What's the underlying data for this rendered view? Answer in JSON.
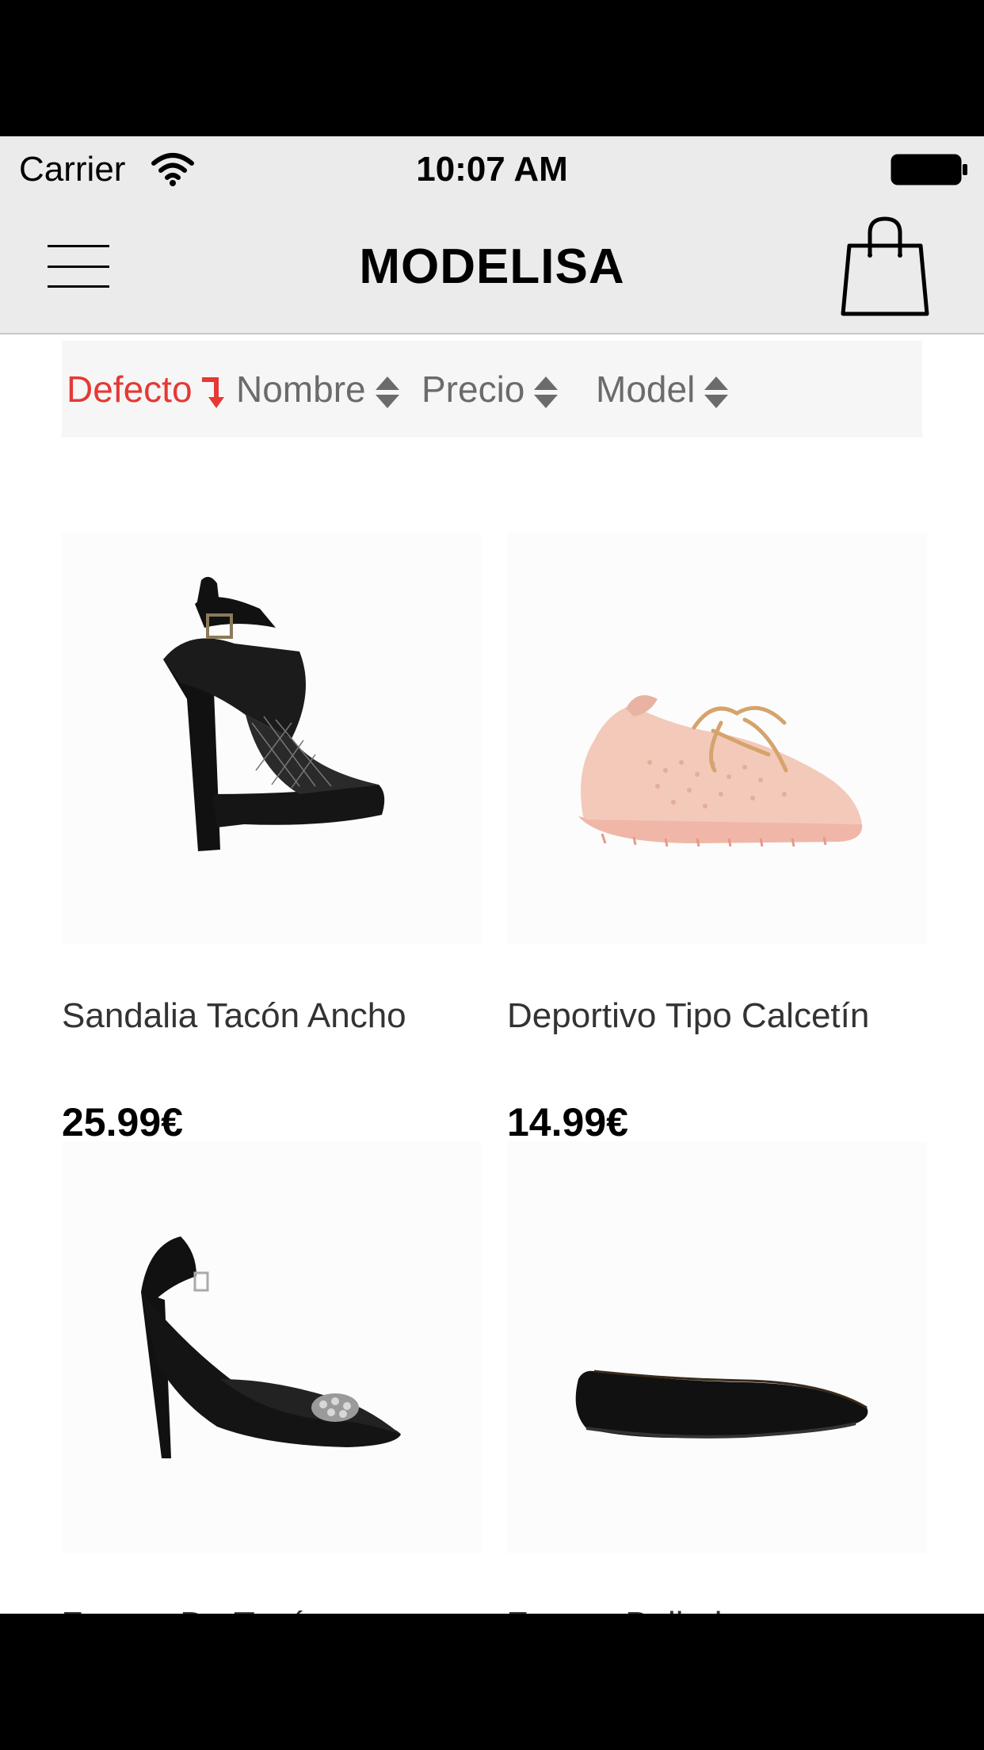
{
  "status_bar": {
    "carrier": "Carrier",
    "time": "10:07 AM"
  },
  "nav": {
    "title": "MODELISA",
    "menu_icon": "hamburger-icon",
    "cart_icon": "shopping-bag-icon"
  },
  "sort": {
    "items": [
      {
        "label": "Defecto",
        "state": "active-descending",
        "icon": "sort-desc-arrow-icon"
      },
      {
        "label": "Nombre",
        "state": "inactive",
        "icon": "sort-updown-icon"
      },
      {
        "label": "Precio",
        "state": "inactive",
        "icon": "sort-updown-icon"
      },
      {
        "label": "Model",
        "state": "inactive",
        "icon": "sort-updown-icon"
      }
    ],
    "active_color": "#e53935",
    "inactive_color": "#6b6b6b"
  },
  "products": [
    {
      "name": "Sandalia Tacón Ancho",
      "price": "25.99€",
      "image": "black-platform-sandal"
    },
    {
      "name": "Deportivo Tipo Calcetín",
      "price": "14.99€",
      "image": "pink-knit-sneaker"
    },
    {
      "name": "Zapato De Tacón",
      "price": "",
      "image": "black-slingback-heel"
    },
    {
      "name": "Zapato Bailarina",
      "price": "",
      "image": "black-ballet-flat"
    }
  ]
}
